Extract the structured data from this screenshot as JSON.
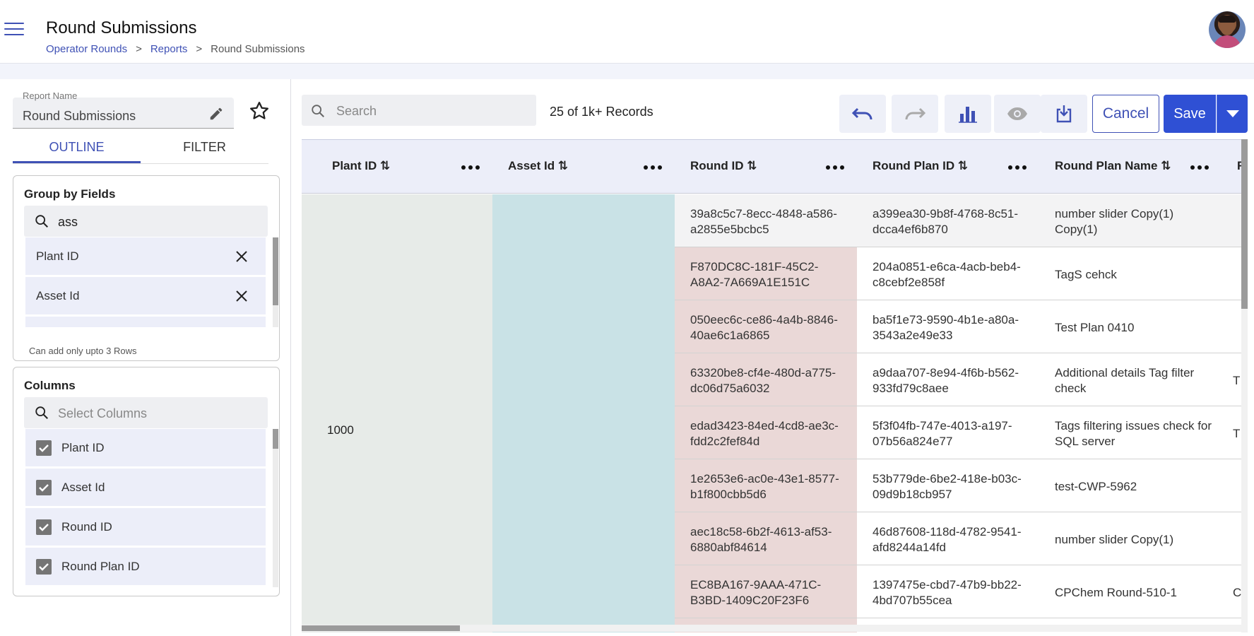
{
  "header": {
    "title": "Round Submissions",
    "breadcrumb": [
      "Operator Rounds",
      "Reports",
      "Round Submissions"
    ],
    "separator": ">"
  },
  "left_panel": {
    "report_name_label": "Report Name",
    "report_name_value": "Round Submissions",
    "tabs": [
      "OUTLINE",
      "FILTER"
    ],
    "active_tab": "OUTLINE",
    "group_by": {
      "title": "Group by Fields",
      "search_value": "ass",
      "items": [
        "Plant ID",
        "Asset Id"
      ],
      "hint": "Can add only upto 3 Rows"
    },
    "columns": {
      "title": "Columns",
      "search_placeholder": "Select Columns",
      "items": [
        "Plant ID",
        "Asset Id",
        "Round ID",
        "Round Plan ID"
      ]
    }
  },
  "toolbar": {
    "search_placeholder": "Search",
    "records_text": "25 of 1k+ Records",
    "cancel_label": "Cancel",
    "save_label": "Save"
  },
  "table": {
    "headers": [
      "Plant ID",
      "Asset Id",
      "Round ID",
      "Round Plan ID",
      "Round Plan Name",
      "R"
    ],
    "sort_glyph": "⇅",
    "plant_value": "1000",
    "rows": [
      {
        "round_id": "39a8c5c7-8ecc-4848-a586-a2855e5bcbc5",
        "round_plan_id": "a399ea30-9b8f-4768-8c51-dcca4ef6b870",
        "round_plan_name": "number slider Copy(1) Copy(1)",
        "extra": ""
      },
      {
        "round_id": "F870DC8C-181F-45C2-A8A2-7A669A1E151C",
        "round_plan_id": "204a0851-e6ca-4acb-beb4-c8cebf2e858f",
        "round_plan_name": "TagS cehck",
        "extra": ""
      },
      {
        "round_id": "050eec6c-ce86-4a4b-8846-40ae6c1a6865",
        "round_plan_id": "ba5f1e73-9590-4b1e-a80a-3543a2e49e33",
        "round_plan_name": "Test Plan 0410",
        "extra": ""
      },
      {
        "round_id": "63320be8-cf4e-480d-a775-dc06d75a6032",
        "round_plan_id": "a9daa707-8e94-4f6b-b562-933fd79c8aee",
        "round_plan_name": "Additional details Tag filter check",
        "extra": "T"
      },
      {
        "round_id": "edad3423-84ed-4cd8-ae3c-fdd2c2fef84d",
        "round_plan_id": "5f3f04fb-747e-4013-a197-07b56a824e77",
        "round_plan_name": "Tags filtering issues check for SQL server",
        "extra": "T"
      },
      {
        "round_id": "1e2653e6-ac0e-43e1-8577-b1f800cbb5d6",
        "round_plan_id": "53b779de-6be2-418e-b03c-09d9b18cb957",
        "round_plan_name": "test-CWP-5962",
        "extra": ""
      },
      {
        "round_id": "aec18c58-6b2f-4613-af53-6880abf84614",
        "round_plan_id": "46d87608-118d-4782-9541-afd8244a14fd",
        "round_plan_name": "number slider Copy(1)",
        "extra": ""
      },
      {
        "round_id": "EC8BA167-9AAA-471C-B3BD-1409C20F23F6",
        "round_plan_id": "1397475e-cbd7-47b9-bb22-4bd707b55cea",
        "round_plan_name": "CPChem Round-510-1",
        "extra": "C"
      }
    ]
  },
  "colors": {
    "accent": "#3f51b5",
    "primary_button": "#2f50d4",
    "header_row": "#eceef9",
    "plant_column": "#e7ebe8",
    "asset_column": "#c9e2e6",
    "round_column": "#ead8d7"
  },
  "icons": {
    "menu": "hamburger-menu-icon",
    "edit": "pencil-icon",
    "favorite": "star-outline-icon",
    "search": "search-icon",
    "remove": "close-icon",
    "checkbox": "checkbox-checked-icon",
    "undo": "undo-icon",
    "redo": "redo-icon",
    "chart": "bar-chart-icon",
    "preview": "eye-icon",
    "download": "download-icon",
    "sort": "sort-icon",
    "more": "more-horizontal-icon"
  }
}
